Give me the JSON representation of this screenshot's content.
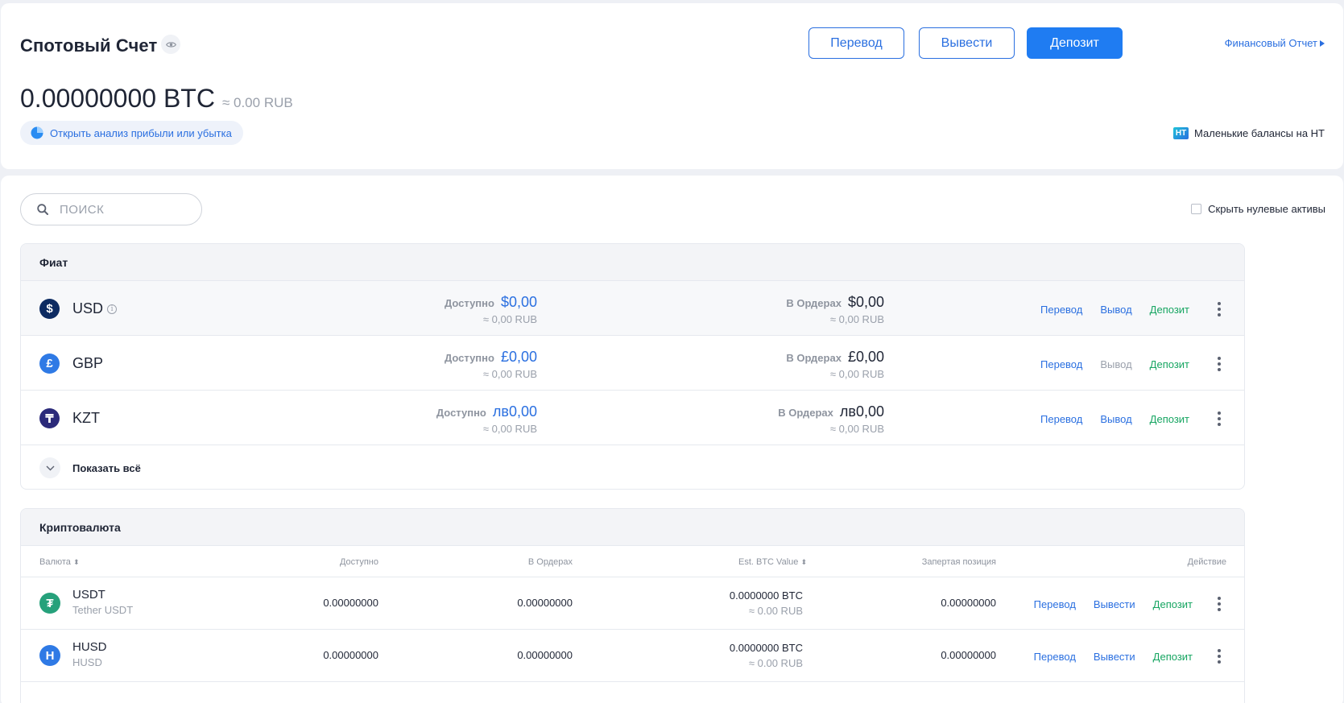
{
  "header": {
    "title": "Спотовый Счет",
    "transfer_label": "Перевод",
    "withdraw_label": "Вывести",
    "deposit_label": "Депозит",
    "financial_report_label": "Финансовый Отчет",
    "balance_btc": "0.00000000 BTC",
    "balance_rub": "≈ 0.00 RUB",
    "pnl_label": "Открыть анализ прибыли или убытка",
    "ht_badge": "HT",
    "small_balances_label": "Маленькие балансы на HT"
  },
  "toolbar": {
    "search_placeholder": "ПОИСК",
    "hide_zero_label": "Скрыть нулевые активы"
  },
  "fiat": {
    "title": "Фиат",
    "available_label": "Доступно",
    "in_orders_label": "В Ордерах",
    "rows": [
      {
        "symbol": "USD",
        "icon_glyph": "$",
        "icon_color": "#0d2b62",
        "available": "$0,00",
        "available_rub": "≈ 0,00 RUB",
        "orders": "$0,00",
        "orders_rub": "≈ 0,00 RUB",
        "transfer": "Перевод",
        "withdraw": "Вывод",
        "deposit": "Депозит"
      },
      {
        "symbol": "GBP",
        "icon_glyph": "£",
        "icon_color": "#2f7ae5",
        "available": "£0,00",
        "available_rub": "≈ 0,00 RUB",
        "orders": "£0,00",
        "orders_rub": "≈ 0,00 RUB",
        "transfer": "Перевод",
        "withdraw": "Вывод",
        "deposit": "Депозит"
      },
      {
        "symbol": "KZT",
        "icon_glyph": "₸",
        "icon_color": "#2b2a7a",
        "available": "лв0,00",
        "available_rub": "≈ 0,00 RUB",
        "orders": "лв0,00",
        "orders_rub": "≈ 0,00 RUB",
        "transfer": "Перевод",
        "withdraw": "Вывод",
        "deposit": "Депозит"
      }
    ],
    "show_all_label": "Показать всё"
  },
  "crypto": {
    "title": "Криптовалюта",
    "columns": {
      "currency": "Валюта",
      "available": "Доступно",
      "in_orders": "В Ордерах",
      "btc_value": "Est. BTC Value",
      "locked": "Запертая позиция",
      "action": "Действие"
    },
    "rows": [
      {
        "symbol": "USDT",
        "name": "Tether USDT",
        "icon_glyph": "₮",
        "icon_color": "#26a17b",
        "available": "0.00000000",
        "orders": "0.00000000",
        "btc": "0.0000000 BTC",
        "rub": "≈ 0.00 RUB",
        "locked": "0.00000000",
        "transfer": "Перевод",
        "withdraw": "Вывести",
        "deposit": "Депозит"
      },
      {
        "symbol": "HUSD",
        "name": "HUSD",
        "icon_glyph": "H",
        "icon_color": "#2f7ae5",
        "available": "0.00000000",
        "orders": "0.00000000",
        "btc": "0.0000000 BTC",
        "rub": "≈ 0.00 RUB",
        "locked": "0.00000000",
        "transfer": "Перевод",
        "withdraw": "Вывести",
        "deposit": "Депозит"
      }
    ]
  },
  "colors": {
    "accent": "#1f7cf2",
    "link": "#2a6fe0",
    "deposit_green": "#16a561",
    "muted": "#9aa0ab"
  }
}
